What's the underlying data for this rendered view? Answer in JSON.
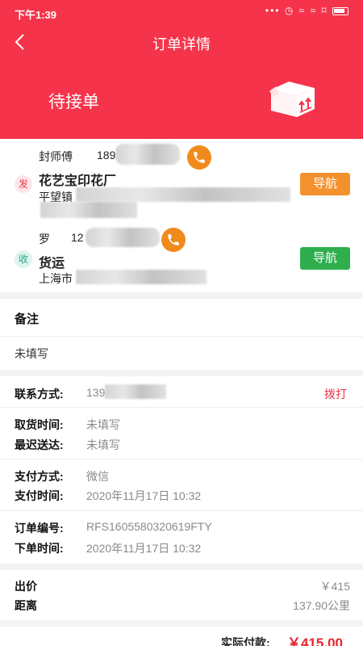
{
  "statusbar": {
    "time": "下午1:39",
    "icons": "••• ◷ ≈ ≈ ⌑"
  },
  "nav": {
    "title": "订单详情"
  },
  "order_status": "待接单",
  "sender": {
    "contact_name": "封师傅",
    "contact_phone_prefix": "189",
    "badge": "发",
    "company": "花艺宝印花厂",
    "address_prefix": "平望镇",
    "nav_button": "导航"
  },
  "receiver": {
    "contact_name": "罗",
    "contact_phone_prefix": "12",
    "badge": "收",
    "company": "货运",
    "address_prefix": "上海市",
    "nav_button": "导航"
  },
  "remarks": {
    "label": "备注",
    "value": "未填写"
  },
  "contact": {
    "label": "联系方式:",
    "value_prefix": "139",
    "action": "拨打"
  },
  "pickup": {
    "label": "取货时间:",
    "value": "未填写"
  },
  "deadline": {
    "label": "最迟送达:",
    "value": "未填写"
  },
  "payment_method": {
    "label": "支付方式:",
    "value": "微信"
  },
  "payment_time": {
    "label": "支付时间:",
    "value": "2020年11月17日 10:32"
  },
  "order_number": {
    "label": "订单编号:",
    "value": "RFS1605580320619FTY"
  },
  "order_time": {
    "label": "下单时间:",
    "value": "2020年11月17日 10:32"
  },
  "price": {
    "label": "出价",
    "value": "￥415"
  },
  "distance": {
    "label": "距离",
    "value": "137.90公里"
  },
  "total": {
    "label": "实际付款:",
    "value": "￥415.00"
  },
  "colors": {
    "brand_red": "#f5334a",
    "orange": "#f3912e",
    "green": "#2fae4e"
  }
}
